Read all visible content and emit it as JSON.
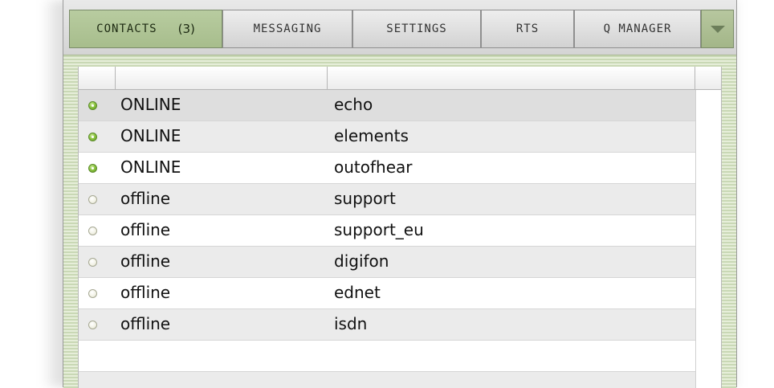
{
  "tabs": [
    {
      "label": "CONTACTS",
      "count": "(3)"
    },
    {
      "label": "MESSAGING"
    },
    {
      "label": "SETTINGS"
    },
    {
      "label": "RTS"
    },
    {
      "label": "Q MANAGER"
    }
  ],
  "tab_menu_icon": "triangle-down-icon",
  "status_colors": {
    "online": "#8cc442",
    "offline": "#e6e6d6",
    "active_tab": "#b0c596"
  },
  "contacts": [
    {
      "status": "ONLINE",
      "name": "echo",
      "presence": "online"
    },
    {
      "status": "ONLINE",
      "name": "elements",
      "presence": "online"
    },
    {
      "status": "ONLINE",
      "name": "outofhear",
      "presence": "online"
    },
    {
      "status": "offline",
      "name": "support",
      "presence": "offline"
    },
    {
      "status": "offline",
      "name": "support_eu",
      "presence": "offline"
    },
    {
      "status": "offline",
      "name": "digifon",
      "presence": "offline"
    },
    {
      "status": "offline",
      "name": "ednet",
      "presence": "offline"
    },
    {
      "status": "offline",
      "name": "isdn",
      "presence": "offline"
    }
  ]
}
